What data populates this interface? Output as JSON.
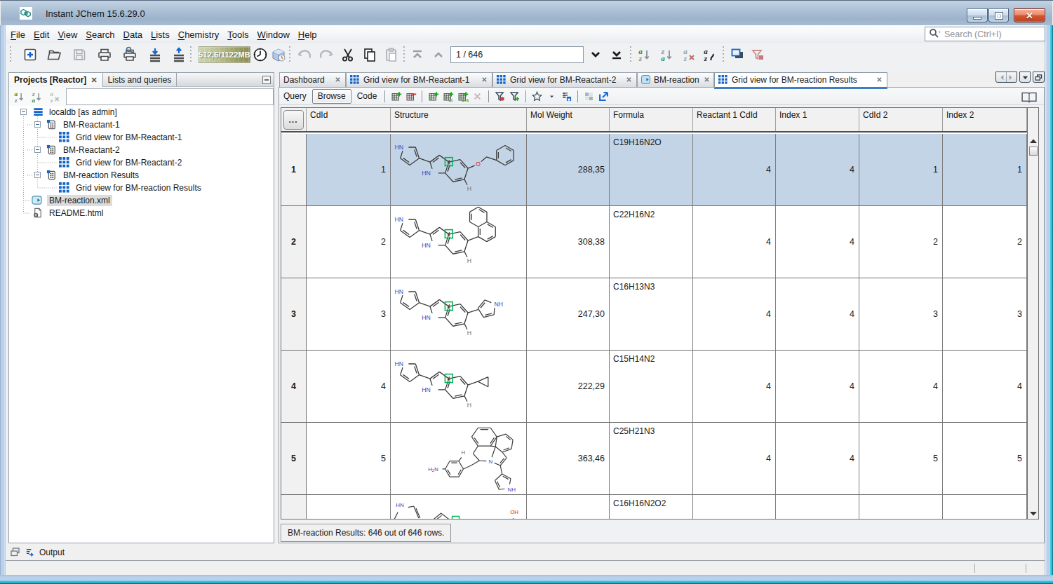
{
  "window": {
    "title": "Instant JChem 15.6.29.0",
    "controls": {
      "minimize": "minimize",
      "maximize": "maximize",
      "close": "close"
    }
  },
  "menu": {
    "items": [
      "File",
      "Edit",
      "View",
      "Search",
      "Data",
      "Lists",
      "Chemistry",
      "Tools",
      "Window",
      "Help"
    ],
    "search_placeholder": "Search (Ctrl+I)"
  },
  "toolbar": {
    "memory": "512,6/1122MB",
    "row_position": "1 / 646"
  },
  "left_panel": {
    "tabs": [
      {
        "label": "Projects [Reactor]",
        "active": true
      },
      {
        "label": "Lists and queries",
        "active": false
      }
    ],
    "filter_value": "",
    "tree": [
      {
        "label": "localdb [as admin]"
      },
      {
        "label": "BM-Reactant-1"
      },
      {
        "label": "Grid view for BM-Reactant-1"
      },
      {
        "label": "BM-Reactant-2"
      },
      {
        "label": "Grid view for BM-Reactant-2"
      },
      {
        "label": "BM-reaction Results"
      },
      {
        "label": "Grid view for BM-reaction Results"
      },
      {
        "label": "BM-reaction.xml",
        "selected": true
      },
      {
        "label": "README.html"
      }
    ]
  },
  "doc_tabs": [
    {
      "label": "Dashboard",
      "icon": "none",
      "active": false
    },
    {
      "label": "Grid view for BM-Reactant-1",
      "icon": "grid",
      "active": false
    },
    {
      "label": "Grid view for BM-Reactant-2",
      "icon": "grid",
      "active": false
    },
    {
      "label": "BM-reaction",
      "icon": "reaction",
      "active": false
    },
    {
      "label": "Grid view for BM-reaction Results",
      "icon": "grid",
      "active": true
    }
  ],
  "query_bar": {
    "query": "Query",
    "browse": "Browse",
    "code": "Code"
  },
  "grid": {
    "corner": "...",
    "columns": [
      "CdId",
      "Structure",
      "Mol Weight",
      "Formula",
      "Reactant 1 CdId",
      "Index 1",
      "CdId 2",
      "Index 2"
    ],
    "rows": [
      {
        "num": "1",
        "cdid": "1",
        "mol_weight": "288,35",
        "formula": "C19H16N2O",
        "reactant1_cdid": "4",
        "index1": "4",
        "cdid2": "1",
        "index2": "1",
        "selected": true
      },
      {
        "num": "2",
        "cdid": "2",
        "mol_weight": "308,38",
        "formula": "C22H16N2",
        "reactant1_cdid": "4",
        "index1": "4",
        "cdid2": "2",
        "index2": "2",
        "selected": false
      },
      {
        "num": "3",
        "cdid": "3",
        "mol_weight": "247,30",
        "formula": "C16H13N3",
        "reactant1_cdid": "4",
        "index1": "4",
        "cdid2": "3",
        "index2": "3",
        "selected": false
      },
      {
        "num": "4",
        "cdid": "4",
        "mol_weight": "222,29",
        "formula": "C15H14N2",
        "reactant1_cdid": "4",
        "index1": "4",
        "cdid2": "4",
        "index2": "4",
        "selected": false
      },
      {
        "num": "5",
        "cdid": "5",
        "mol_weight": "363,46",
        "formula": "C25H21N3",
        "reactant1_cdid": "4",
        "index1": "4",
        "cdid2": "5",
        "index2": "5",
        "selected": false
      },
      {
        "num": "",
        "cdid": "",
        "mol_weight": "",
        "formula": "C16H16N2O2",
        "reactant1_cdid": "",
        "index1": "",
        "cdid2": "",
        "index2": "",
        "selected": false
      }
    ]
  },
  "status_box": {
    "text": "BM-reaction Results: 646 out of 646 rows."
  },
  "output_bar": {
    "label": "Output"
  },
  "colors": {
    "selection_blue": "#c3d4e6",
    "tab_accent_blue": "#3f7cc0",
    "icon_blue": "#1464c8",
    "close_red": "#cf4c2d"
  }
}
